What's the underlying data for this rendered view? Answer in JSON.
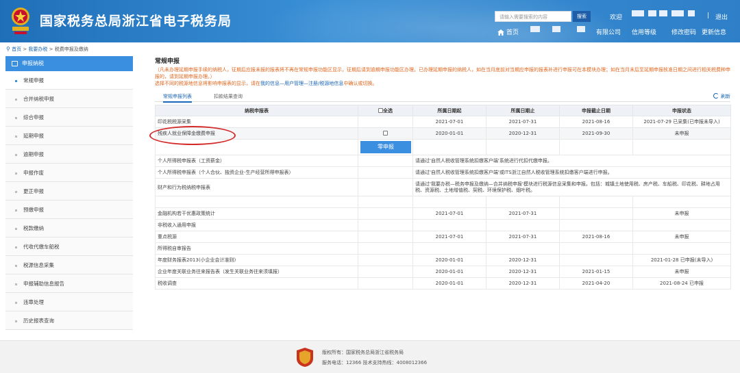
{
  "header": {
    "site_title": "国家税务总局浙江省电子税务局",
    "search_placeholder": "请输入需要搜索的内容",
    "search_button": "搜索",
    "welcome": "欢迎",
    "logout": "退出",
    "home": "首页",
    "company_suffix": "有限公司",
    "nav_links": [
      "信用等级",
      "修改密码",
      "更新信息"
    ],
    "colors": {
      "header": "#2e7fc7",
      "accent": "#3b8fe0",
      "notice": "#e2661d",
      "highlight_circle": "#d42a2a"
    }
  },
  "breadcrumb": [
    "首页",
    "我要办税",
    "税费申报及缴纳"
  ],
  "sidebar": {
    "section": "申报纳税",
    "items": [
      {
        "label": "常规申报",
        "active": true
      },
      {
        "label": "合并纳税申报"
      },
      {
        "label": "综合申报"
      },
      {
        "label": "延期申报"
      },
      {
        "label": "逾期申报"
      },
      {
        "label": "申报作废"
      },
      {
        "label": "更正申报"
      },
      {
        "label": "预缴申报"
      },
      {
        "label": "税款缴纳"
      },
      {
        "label": "代收代缴车船税"
      },
      {
        "label": "税源信息采集"
      },
      {
        "label": "申报辅助信息报告"
      },
      {
        "label": "违章处理"
      },
      {
        "label": "历史报表查询"
      }
    ]
  },
  "main": {
    "title": "常规申报",
    "notice_line1": "（凡未办理延期申报手续的纳税人，征期后应报未报的报表将不再在常规申报功能区显示，征期后请到逾期申报功能区办理。已办理延期申报的纳税人，如在当月底前对当期应申报的报表补进行申报可在本模块办理；如在当月末后至延期申报核准日期之间进行相关税费种申报的，请到延期申报办理。）",
    "notice_line2_prefix": "选择不同的税源地信息将影响申报表的显示，请在",
    "notice_line2_link": "我的信息—用户管理—注册/税源地信息",
    "notice_line2_suffix": "中确认或切换。",
    "tabs": [
      "常规申报列表",
      "扣款结果查询"
    ],
    "refresh": "刷新",
    "table": {
      "headers": [
        "纳税申报表",
        "全选",
        "所属日期起",
        "所属日期止",
        "申报截止日期",
        "申报状态"
      ],
      "rows": [
        {
          "name": "印花税税源采集",
          "start": "2021-07-01",
          "end": "2021-07-31",
          "deadline": "2021-08-16",
          "status": "2021-07-29 已采集(已申报未导入)"
        },
        {
          "name": "残疾人就业保障金缴费申报",
          "checkbox": true,
          "start": "2020-01-01",
          "end": "2020-12-31",
          "deadline": "2021-09-30",
          "status": "未申报"
        },
        {
          "zero_button": "零申报"
        },
        {
          "name": "个人所得税申报表（工资薪金）",
          "note": "请通过'自然人税收管理系统扣缴客户端'系统进行代扣代缴申报。"
        },
        {
          "name": "个人所得税申报表（个人合伙、独资企业-生产经营所得申报表）",
          "note": "请通过'自然人税收管理系统扣缴客户端'或ITS浙江自然人税收管理系统扣缴客户端进行申报。"
        },
        {
          "name": "财产和行为税纳税申报表",
          "note": "请通过'我要办税—税务申报及缴纳—合并纳税申报'模块进行税源信息采集和申报。包括：城镇土地使用税、房产税、车船税、印花税、耕地占用税、资源税、土地增值税、契税、环境保护税、烟叶税。"
        },
        {
          "name": ""
        },
        {
          "name": "金融机构若干优惠政策统计",
          "start": "2021-07-01",
          "end": "2021-07-31",
          "deadline": "",
          "status": "未申报"
        },
        {
          "name": "非税收入通用申报"
        },
        {
          "name": "重点税源",
          "start": "2021-07-01",
          "end": "2021-07-31",
          "deadline": "2021-08-16",
          "status": "未申报"
        },
        {
          "name": "所得税自审报告"
        },
        {
          "name": "年度财务报表2013(小企业会计准则)",
          "start": "2020-01-01",
          "end": "2020-12-31",
          "deadline": "",
          "status": "2021-01-28 已申报(未导入)"
        },
        {
          "name": "企业年度关联业务往来报告表（发生关联业务往来须填报）",
          "start": "2020-01-01",
          "end": "2020-12-31",
          "deadline": "2021-01-15",
          "status": "未申报"
        },
        {
          "name": "税收调查",
          "start": "2020-01-01",
          "end": "2020-12-31",
          "deadline": "2021-04-20",
          "status": "2021-08-24 已申报"
        }
      ]
    }
  },
  "footer": {
    "copyright": "版权所有：国家税务总局浙江省税务局",
    "contact": "服务电话：12366    技术支持热线：4008012366"
  }
}
